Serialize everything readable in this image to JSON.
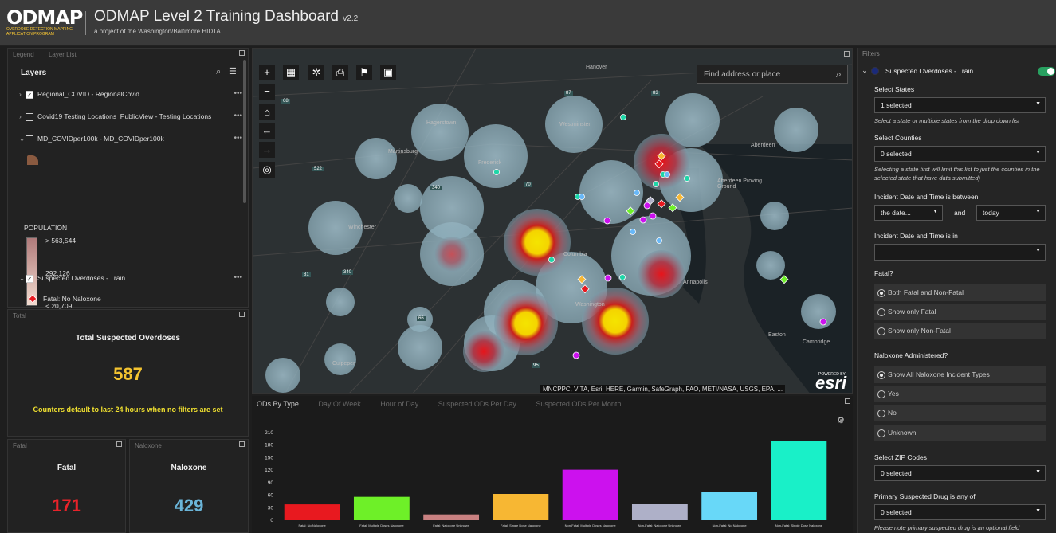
{
  "header": {
    "logo_text": "ODMAP",
    "logo_sub": "OVERDOSE DETECTION MAPPING APPLICATION PROGRAM",
    "title": "ODMAP Level 2 Training Dashboard",
    "version": "v2.2",
    "subtitle": "a project of the Washington/Baltimore HIDTA"
  },
  "legend_panel": {
    "tabs": [
      "Legend",
      "Layer List"
    ],
    "layers_title": "Layers",
    "layers": [
      {
        "label": "Regional_COVID - RegionalCovid",
        "checked": true
      },
      {
        "label": "Covid19 Testing Locations_PublicView - Testing Locations",
        "checked": false
      },
      {
        "label": "MD_COVIDper100k - MD_COVIDper100k",
        "checked": false
      },
      {
        "label": "Suspected Overdoses - Train",
        "checked": true
      }
    ],
    "population_label": "POPULATION",
    "ramp_labels": [
      "> 563,544",
      "292,126",
      "< 20,709"
    ],
    "symbol_label": "Fatal: No Naloxone",
    "more_glyph": "•••"
  },
  "total_panel": {
    "header": "Total",
    "title": "Total Suspected Overdoses",
    "value": "587",
    "note": "Counters default to last 24 hours when no filters are set"
  },
  "fatal_panel": {
    "header": "Fatal",
    "title": "Fatal",
    "value": "171",
    "color": "#e8232a"
  },
  "naloxone_panel": {
    "header": "Naloxone",
    "title": "Naloxone",
    "value": "429",
    "color": "#6ab4d8"
  },
  "map": {
    "search_placeholder": "Find address or place",
    "attribution": "MNCPPC, VITA, Esri, HERE, Garmin, SafeGraph, FAO, METI/NASA, USGS, EPA, ...",
    "esri_powered": "POWERED BY",
    "esri": "esri",
    "places": [
      "Hanover",
      "Hagerstown",
      "Westminster",
      "Frederick",
      "Martinsburg",
      "Aberdeen",
      "Winchester",
      "Annapolis",
      "Washington",
      "Easton",
      "Culpeper",
      "Cambridge",
      "Aberdeen Proving Ground",
      "Columbia"
    ],
    "route_shields": [
      "81",
      "70",
      "83",
      "340",
      "522",
      "66",
      "95",
      "87",
      "68",
      "340"
    ]
  },
  "chart_panel": {
    "tabs": [
      "ODs By Type",
      "Day Of Week",
      "Hour of Day",
      "Suspected ODs Per Day",
      "Suspected ODs Per Month"
    ],
    "active_tab": "ODs By Type"
  },
  "chart_data": {
    "type": "bar",
    "categories": [
      "Fatal: No Naloxone",
      "Fatal: Multiple Doses Naloxone",
      "Fatal: Naloxone Unknown",
      "Fatal: Single Dose Naloxone",
      "Non-Fatal: Multiple Doses Naloxone",
      "Non-Fatal: Naloxone Unknown",
      "Non-Fatal: No Naloxone",
      "Non-Fatal: Single Dose Naloxone"
    ],
    "values": [
      38,
      56,
      14,
      63,
      121,
      39,
      67,
      189
    ],
    "colors": [
      "#e8191f",
      "#6ef028",
      "#c98181",
      "#f7b733",
      "#cc11ee",
      "#aeb0c8",
      "#68d8f8",
      "#19f0c8"
    ],
    "yticks": [
      0,
      30,
      60,
      90,
      120,
      150,
      180,
      210
    ],
    "ylim": [
      0,
      210
    ]
  },
  "filters": {
    "header": "Filters",
    "layer_name": "Suspected Overdoses - Train",
    "states_label": "Select States",
    "states_value": "1 selected",
    "states_hint": "Select a state or multiple states from the drop down list",
    "counties_label": "Select Counties",
    "counties_value": "0 selected",
    "counties_hint": "Selecting a state first will limit this list to just the counties in the selected state that have data submitted)",
    "date_between_label": "Incident Date and Time is between",
    "date_from": "the date...",
    "date_and": "and",
    "date_to": "today",
    "date_in_label": "Incident Date and Time is in",
    "fatal_label": "Fatal?",
    "fatal_options": [
      "Both Fatal and Non-Fatal",
      "Show only Fatal",
      "Show only Non-Fatal"
    ],
    "naloxone_label": "Naloxone Administered?",
    "naloxone_options": [
      "Show All Naloxone Incident Types",
      "Yes",
      "No",
      "Unknown"
    ],
    "zip_label": "Select ZIP Codes",
    "zip_value": "0 selected",
    "drug_label": "Primary Suspected Drug is any of",
    "drug_value": "0 selected",
    "drug_hint": "Please note primary suspected drug is an optional field"
  }
}
